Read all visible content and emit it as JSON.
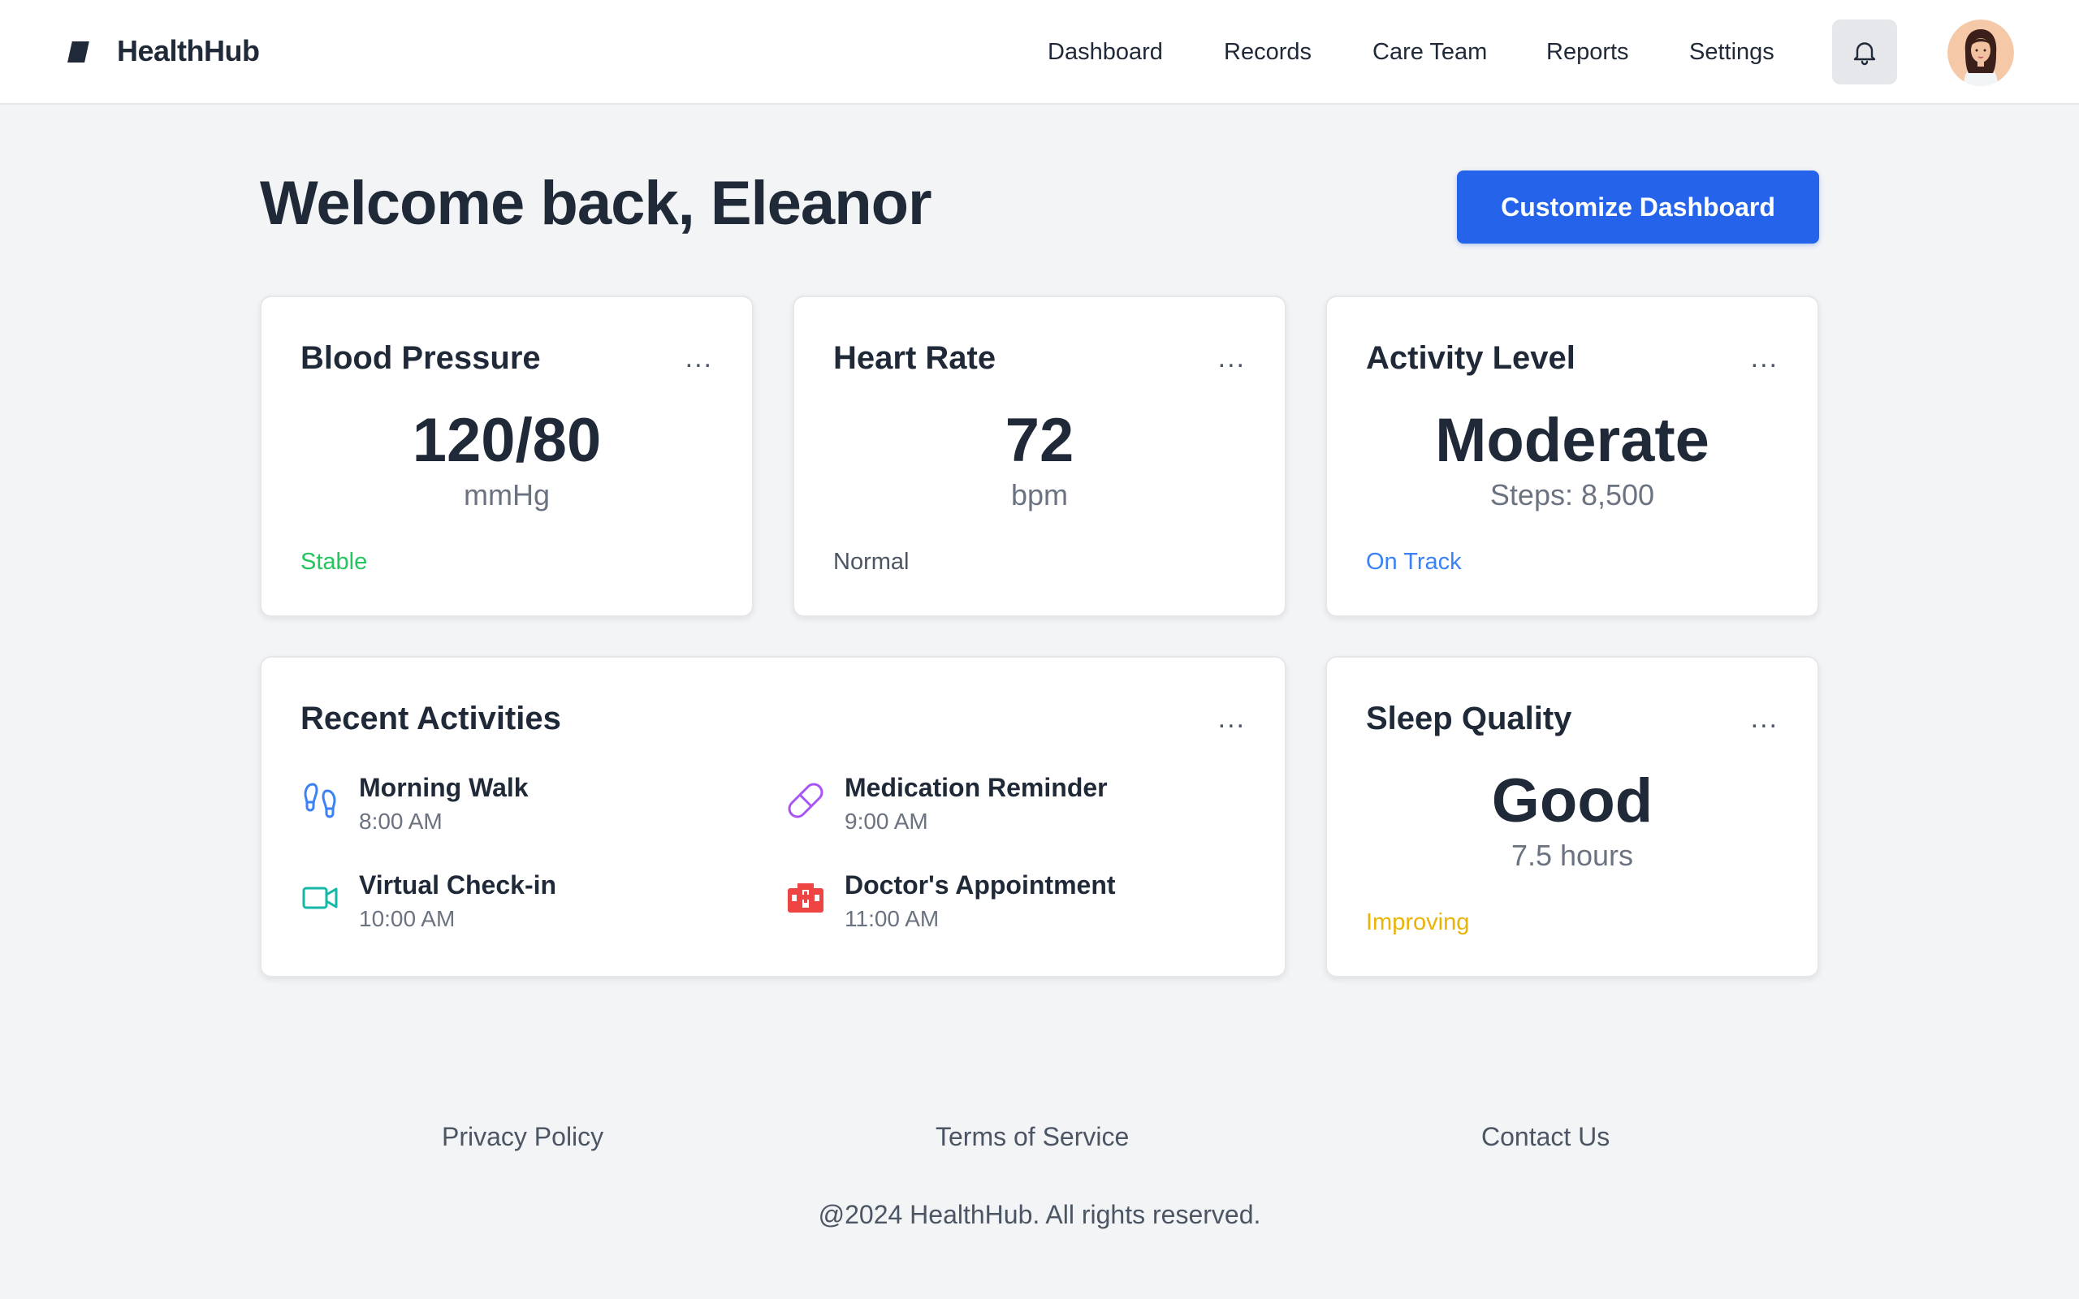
{
  "app": {
    "brand": "HealthHub",
    "logo_icon": "health-logo-icon"
  },
  "nav": {
    "items": [
      {
        "label": "Dashboard"
      },
      {
        "label": "Records"
      },
      {
        "label": "Care Team"
      },
      {
        "label": "Reports"
      },
      {
        "label": "Settings"
      }
    ],
    "notification_icon": "bell-icon",
    "avatar": "user-avatar"
  },
  "page": {
    "welcome": "Welcome back, Eleanor",
    "customize_label": "Customize Dashboard"
  },
  "cards": {
    "blood_pressure": {
      "title": "Blood Pressure",
      "menu": "...",
      "value": "120/80",
      "unit": "mmHg",
      "status": "Stable",
      "status_color": "#22c55e"
    },
    "heart_rate": {
      "title": "Heart Rate",
      "menu": "...",
      "value": "72",
      "unit": "bpm",
      "status": "Normal",
      "status_color": "#4b5563"
    },
    "activity_level": {
      "title": "Activity Level",
      "menu": "...",
      "value": "Moderate",
      "unit": "Steps: 8,500",
      "status": "On Track",
      "status_color": "#3b82f6"
    },
    "recent_activities": {
      "title": "Recent Activities",
      "menu": "...",
      "items": [
        {
          "name": "Morning Walk",
          "time": "8:00 AM",
          "icon": "footprints-icon",
          "color": "#3b82f6"
        },
        {
          "name": "Medication Reminder",
          "time": "9:00 AM",
          "icon": "pill-icon",
          "color": "#a855f7"
        },
        {
          "name": "Virtual Check-in",
          "time": "10:00 AM",
          "icon": "video-camera-icon",
          "color": "#14b8a6"
        },
        {
          "name": "Doctor's Appointment",
          "time": "11:00 AM",
          "icon": "hospital-icon",
          "color": "#ef4444"
        }
      ]
    },
    "sleep_quality": {
      "title": "Sleep Quality",
      "menu": "...",
      "value": "Good",
      "unit": "7.5 hours",
      "status": "Improving",
      "status_color": "#eab308"
    }
  },
  "colors": {
    "accent": "#2563eb",
    "background": "#f3f4f6",
    "text": "#1f2937"
  },
  "footer": {
    "links": [
      {
        "label": "Privacy Policy"
      },
      {
        "label": "Terms of Service"
      },
      {
        "label": "Contact Us"
      }
    ],
    "copyright": "@2024 HealthHub. All rights reserved."
  }
}
